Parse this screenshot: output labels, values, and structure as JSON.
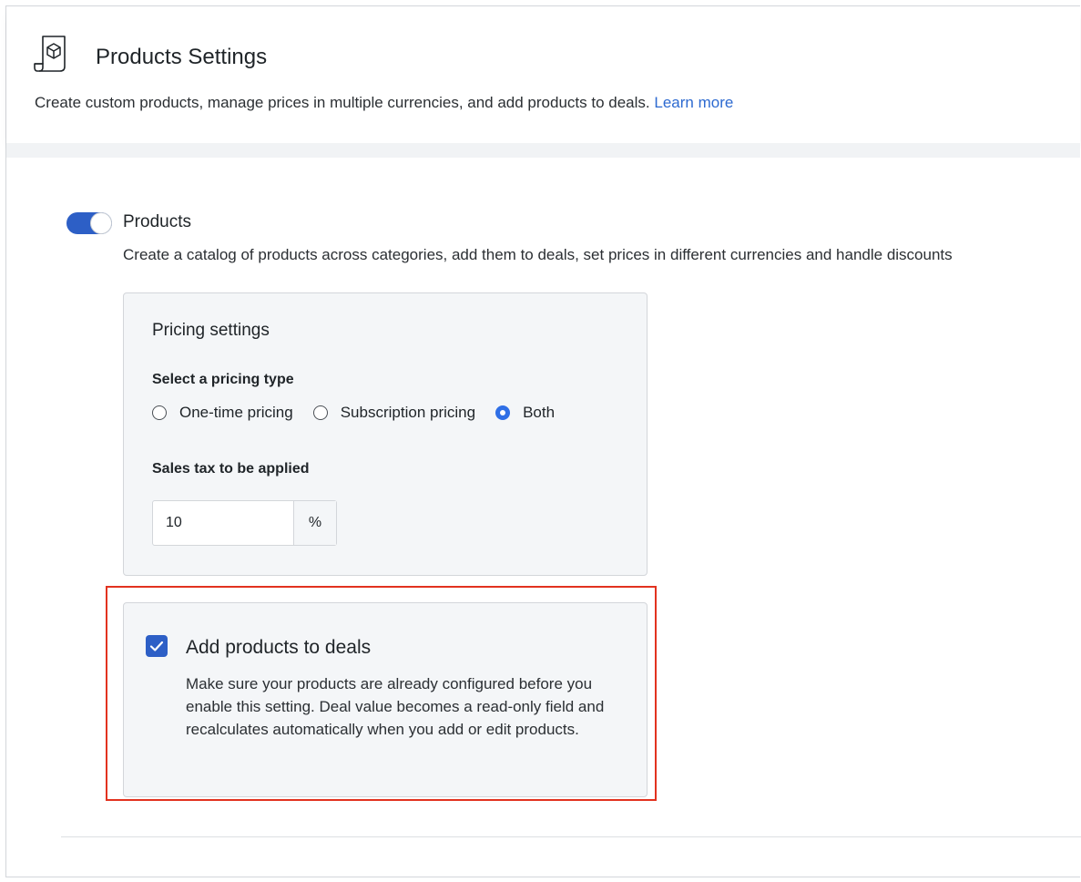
{
  "header": {
    "title": "Products Settings",
    "subtitle": "Create custom products, manage prices in multiple currencies, and add products to deals.",
    "learn_more": "Learn more"
  },
  "products": {
    "toggle_on": true,
    "title": "Products",
    "description": "Create a catalog of products across categories, add them to deals, set prices in different currencies and handle discounts"
  },
  "pricing": {
    "title": "Pricing settings",
    "type_label": "Select a pricing type",
    "options": [
      "One-time pricing",
      "Subscription pricing",
      "Both"
    ],
    "selected": "Both",
    "tax_label": "Sales tax to be applied",
    "tax_value": "10",
    "tax_unit": "%"
  },
  "deals": {
    "checked": true,
    "title": "Add products to deals",
    "description": "Make sure your products are already configured before you enable this setting. Deal value becomes a read-only field and recalculates automatically when you add or edit products."
  },
  "colors": {
    "accent": "#2d5fc6",
    "radio_selected": "#2f6fe6",
    "highlight": "#e2321f",
    "link": "#2d6ad0"
  }
}
